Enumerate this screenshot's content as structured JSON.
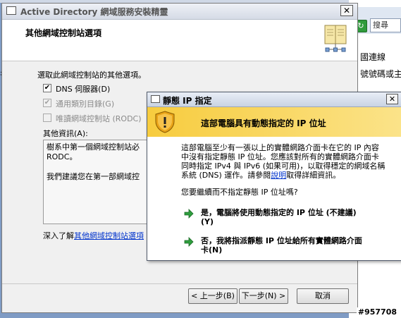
{
  "background": {
    "search_placeholder": "搜尋",
    "text_line1": "國連線",
    "text_line2": "號號碼或主",
    "left_edge_text": "名",
    "watermark": "#957708"
  },
  "wizard": {
    "title": "Active Directory 網域服務安裝精靈",
    "close_glyph": "✕",
    "header_title": "其他網域控制站選項",
    "intro": "選取此網域控制站的其他選項。",
    "checkboxes": [
      {
        "label": "DNS 伺服器(D)",
        "checked": true,
        "enabled": true
      },
      {
        "label": "通用類別目錄(G)",
        "checked": true,
        "enabled": false
      },
      {
        "label": "唯讀網域控制站 (RODC)",
        "checked": false,
        "enabled": false
      }
    ],
    "info_label": "其他資訊(A):",
    "info_lines": [
      "樹系中第一個網域控制站必",
      "RODC。",
      "",
      "我們建議您在第一部網域控"
    ],
    "learn_more_prefix": "深入了解",
    "learn_more_link": "其他網域控制站選項",
    "buttons": {
      "back": "< 上一步(B)",
      "next": "下一步(N) >",
      "cancel": "取消"
    }
  },
  "dialog": {
    "title": "靜態 IP 指定",
    "close_glyph": "✕",
    "banner_text": "這部電腦具有動態指定的 IP 位址",
    "body_lines": [
      "這部電腦至少有一張以上的實體網路介面卡在它的 IP 內容",
      "中沒有指定靜態 IP 位址。您應該對所有的實體網路介面卡",
      "同時指定 IPv4 與 IPv6 (如果可用)，以取得穩定的網域名稱",
      "系統 (DNS) 運作。請參閱"
    ],
    "body_link": "說明",
    "body_suffix": "取得詳細資訊。",
    "question": "您要繼續而不指定靜態 IP 位址嗎?",
    "option_yes_line1": "是，電腦將使用動態指定的 IP 位址 (不建議)",
    "option_yes_line2": "(Y)",
    "option_no_line1": "否，我將指派靜態 IP 位址給所有實體網路介面",
    "option_no_line2": "卡(N)"
  }
}
